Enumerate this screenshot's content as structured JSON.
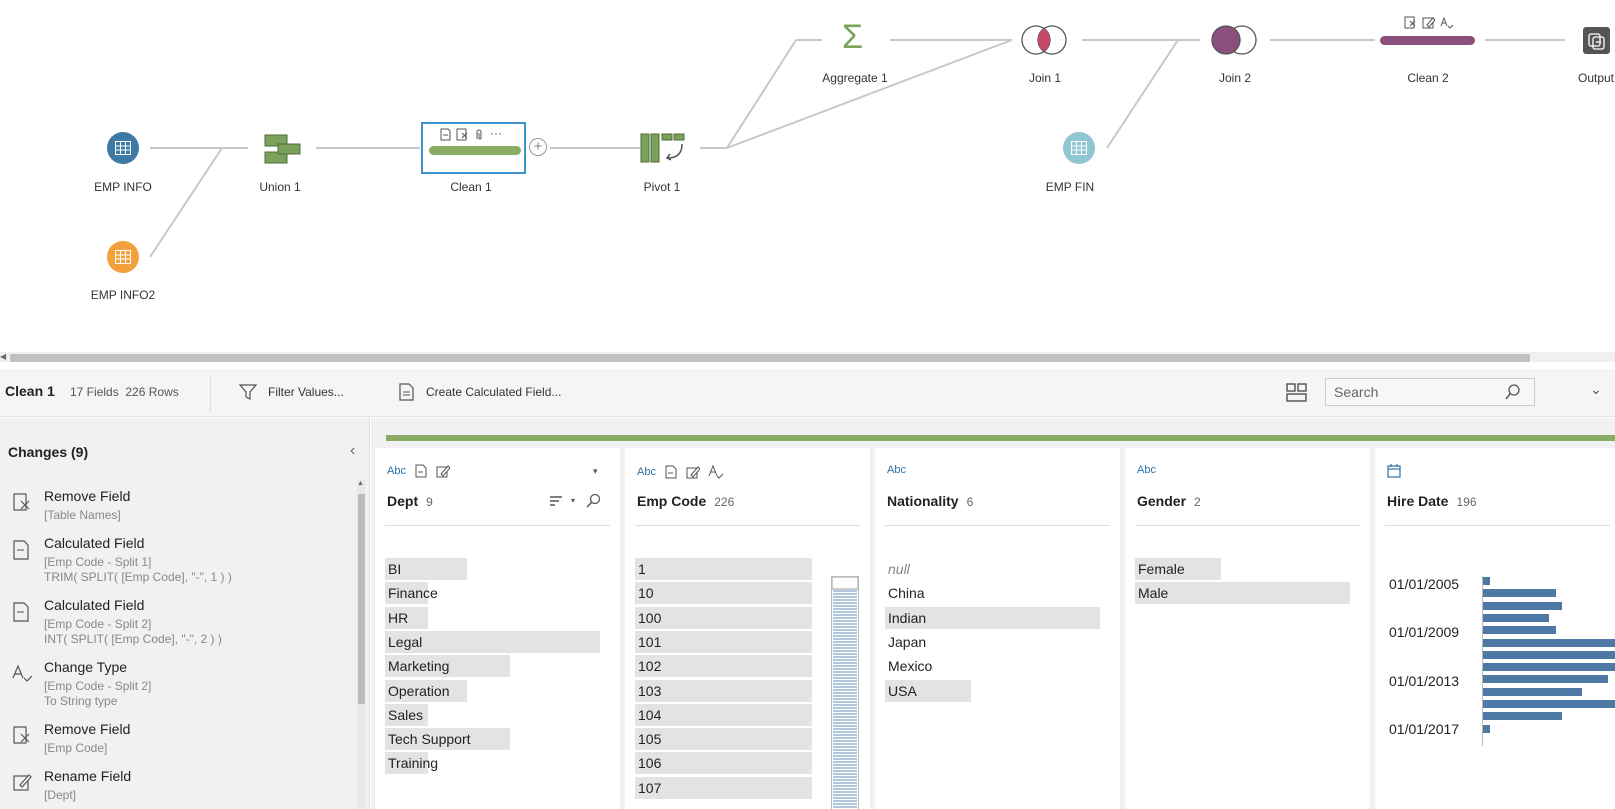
{
  "flow": {
    "nodes": {
      "emp_info": "EMP INFO",
      "emp_info2": "EMP INFO2",
      "union1": "Union 1",
      "clean1": "Clean 1",
      "pivot1": "Pivot 1",
      "aggregate1": "Aggregate 1",
      "join1": "Join 1",
      "emp_fin": "EMP FIN",
      "join2": "Join 2",
      "clean2": "Clean 2",
      "output": "Output"
    }
  },
  "toolbar": {
    "step_name": "Clean 1",
    "fields": "17 Fields",
    "rows": "226 Rows",
    "filter_label": "Filter Values...",
    "calc_label": "Create Calculated Field...",
    "search_placeholder": "Search"
  },
  "changes": {
    "title": "Changes (9)",
    "items": [
      {
        "title": "Remove Field",
        "sub1": "[Table Names]",
        "sub2": "",
        "icon": "remove-field-icon"
      },
      {
        "title": "Calculated Field",
        "sub1": "[Emp Code - Split 1]",
        "sub2": "TRIM( SPLIT( [Emp Code], \"-\", 1 ) )",
        "icon": "calculated-field-icon"
      },
      {
        "title": "Calculated Field",
        "sub1": "[Emp Code - Split 2]",
        "sub2": "INT( SPLIT( [Emp Code], \"-\", 2 ) )",
        "icon": "calculated-field-icon"
      },
      {
        "title": "Change Type",
        "sub1": "[Emp Code - Split 2]",
        "sub2": "To String type",
        "icon": "change-type-icon"
      },
      {
        "title": "Remove Field",
        "sub1": "[Emp Code]",
        "sub2": "",
        "icon": "remove-field-icon"
      },
      {
        "title": "Rename Field",
        "sub1": "[Dept]",
        "sub2": "",
        "icon": "rename-field-icon"
      }
    ]
  },
  "columns": {
    "dept": {
      "type": "Abc",
      "name": "Dept",
      "count": "9",
      "values": [
        {
          "label": "BI",
          "frac": 0.38
        },
        {
          "label": "Finance",
          "frac": 0.2
        },
        {
          "label": "HR",
          "frac": 0.2
        },
        {
          "label": "Legal",
          "frac": 1.0
        },
        {
          "label": "Marketing",
          "frac": 0.58
        },
        {
          "label": "Operation",
          "frac": 0.38
        },
        {
          "label": "Sales",
          "frac": 0.2
        },
        {
          "label": "Tech Support",
          "frac": 0.58
        },
        {
          "label": "Training",
          "frac": 0.2
        }
      ]
    },
    "emp_code": {
      "type": "Abc",
      "name": "Emp Code",
      "count": "226",
      "values": [
        "1",
        "10",
        "100",
        "101",
        "102",
        "103",
        "104",
        "105",
        "106",
        "107"
      ]
    },
    "nationality": {
      "type": "Abc",
      "name": "Nationality",
      "count": "6",
      "values": [
        {
          "label": "null",
          "frac": 0.0,
          "is_null": true
        },
        {
          "label": "China",
          "frac": 0.0
        },
        {
          "label": "Indian",
          "frac": 1.0
        },
        {
          "label": "Japan",
          "frac": 0.0
        },
        {
          "label": "Mexico",
          "frac": 0.0
        },
        {
          "label": "USA",
          "frac": 0.4
        }
      ]
    },
    "gender": {
      "type": "Abc",
      "name": "Gender",
      "count": "2",
      "values": [
        {
          "label": "Female",
          "frac": 0.4
        },
        {
          "label": "Male",
          "frac": 1.0
        }
      ]
    },
    "hire_date": {
      "name": "Hire Date",
      "count": "196",
      "ticks": [
        "01/01/2005",
        "01/01/2009",
        "01/01/2013",
        "01/01/2017"
      ],
      "bins": [
        0.05,
        0.55,
        0.6,
        0.5,
        0.55,
        1.0,
        1.0,
        1.0,
        0.95,
        0.75,
        1.0,
        0.6,
        0.05
      ]
    }
  },
  "colors": {
    "clean_green": "#8aab62",
    "emp_info_blue": "#3d7ba4",
    "emp_info2_orange": "#f3a13b",
    "emp_fin_teal": "#8ec6d1",
    "join_purple": "#8a4f7d",
    "join1_red": "#c64a68",
    "aggregate_green": "#7ba25b",
    "hist_blue": "#4e79a7",
    "selection": "#3b93d1"
  }
}
